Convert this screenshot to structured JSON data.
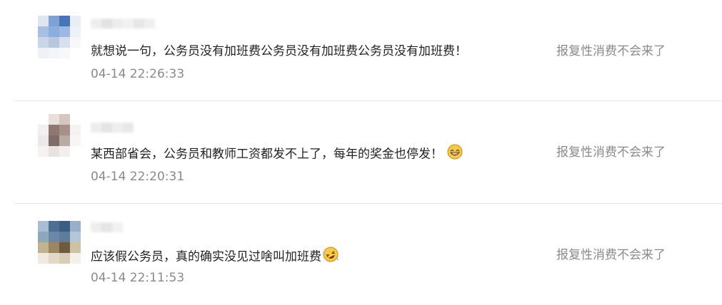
{
  "comments": [
    {
      "text": "就想说一句，公务员没有加班费公务员没有加班费公务员没有加班费！",
      "time": "04-14 22:26:33",
      "action": "报复性消费不会来了",
      "emoji": "",
      "colors": {
        "avatar_primary": "#5b84c4",
        "avatar_secondary": "#a9c2e6"
      }
    },
    {
      "text": "某西部省会，公务员和教师工资都发不上了，每年的奖金也停发！",
      "time": "04-14 22:20:31",
      "action": "报复性消费不会来了",
      "emoji": "grinning-face-icon",
      "colors": {
        "avatar_primary": "#8a6d65",
        "avatar_secondary": "#c9bdb6"
      }
    },
    {
      "text": "应该假公务员，真的确实没见过啥叫加班费",
      "time": "04-14 22:11:53",
      "action": "报复性消费不会来了",
      "emoji": "rolling-laughing-face-icon",
      "colors": {
        "avatar_primary": "#3d5f84",
        "avatar_secondary": "#c7b79a"
      }
    }
  ]
}
